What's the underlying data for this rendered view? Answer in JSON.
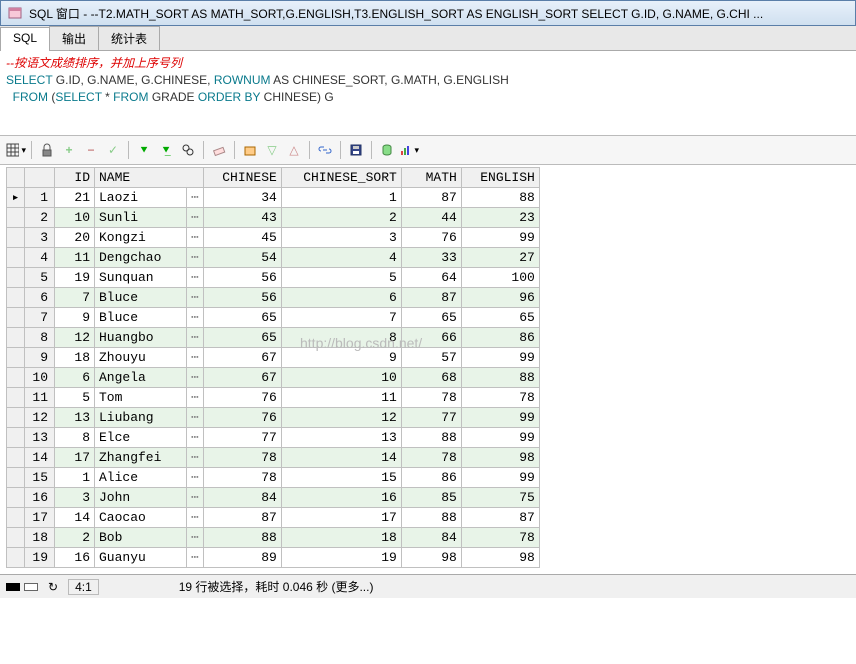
{
  "window": {
    "title": "SQL 窗口 - --T2.MATH_SORT AS MATH_SORT,G.ENGLISH,T3.ENGLISH_SORT AS ENGLISH_SORT SELECT G.ID, G.NAME, G.CHI ..."
  },
  "tabs": {
    "items": [
      "SQL",
      "输出",
      "统计表"
    ],
    "active_index": 0
  },
  "sql": {
    "comment": "--按语文成绩排序，并加上序号列",
    "line1_kw1": "SELECT",
    "line1_rest": " G.ID, G.NAME, G.CHINESE, ",
    "line1_kw2": "ROWNUM",
    "line1_rest2": " AS CHINESE_SORT, G.MATH, G.ENGLISH",
    "line2_kw1": "FROM",
    "line2_rest1": " (",
    "line2_kw2": "SELECT",
    "line2_rest2": " * ",
    "line2_kw3": "FROM",
    "line2_rest3": " GRADE ",
    "line2_kw4": "ORDER",
    "line2_kw5": "BY",
    "line2_rest4": " CHINESE) G"
  },
  "grid": {
    "headers": [
      "ID",
      "NAME",
      "CHINESE",
      "CHINESE_SORT",
      "MATH",
      "ENGLISH"
    ],
    "rows": [
      {
        "n": 1,
        "id": 21,
        "name": "Laozi",
        "chinese": 34,
        "sort": 1,
        "math": 87,
        "english": 88
      },
      {
        "n": 2,
        "id": 10,
        "name": "Sunli",
        "chinese": 43,
        "sort": 2,
        "math": 44,
        "english": 23
      },
      {
        "n": 3,
        "id": 20,
        "name": "Kongzi",
        "chinese": 45,
        "sort": 3,
        "math": 76,
        "english": 99
      },
      {
        "n": 4,
        "id": 11,
        "name": "Dengchao",
        "chinese": 54,
        "sort": 4,
        "math": 33,
        "english": 27
      },
      {
        "n": 5,
        "id": 19,
        "name": "Sunquan",
        "chinese": 56,
        "sort": 5,
        "math": 64,
        "english": 100
      },
      {
        "n": 6,
        "id": 7,
        "name": "Bluce",
        "chinese": 56,
        "sort": 6,
        "math": 87,
        "english": 96
      },
      {
        "n": 7,
        "id": 9,
        "name": "Bluce",
        "chinese": 65,
        "sort": 7,
        "math": 65,
        "english": 65
      },
      {
        "n": 8,
        "id": 12,
        "name": "Huangbo",
        "chinese": 65,
        "sort": 8,
        "math": 66,
        "english": 86
      },
      {
        "n": 9,
        "id": 18,
        "name": "Zhouyu",
        "chinese": 67,
        "sort": 9,
        "math": 57,
        "english": 99
      },
      {
        "n": 10,
        "id": 6,
        "name": "Angela",
        "chinese": 67,
        "sort": 10,
        "math": 68,
        "english": 88
      },
      {
        "n": 11,
        "id": 5,
        "name": "Tom",
        "chinese": 76,
        "sort": 11,
        "math": 78,
        "english": 78
      },
      {
        "n": 12,
        "id": 13,
        "name": "Liubang",
        "chinese": 76,
        "sort": 12,
        "math": 77,
        "english": 99
      },
      {
        "n": 13,
        "id": 8,
        "name": "Elce",
        "chinese": 77,
        "sort": 13,
        "math": 88,
        "english": 99
      },
      {
        "n": 14,
        "id": 17,
        "name": "Zhangfei",
        "chinese": 78,
        "sort": 14,
        "math": 78,
        "english": 98
      },
      {
        "n": 15,
        "id": 1,
        "name": "Alice",
        "chinese": 78,
        "sort": 15,
        "math": 86,
        "english": 99
      },
      {
        "n": 16,
        "id": 3,
        "name": "John",
        "chinese": 84,
        "sort": 16,
        "math": 85,
        "english": 75
      },
      {
        "n": 17,
        "id": 14,
        "name": "Caocao",
        "chinese": 87,
        "sort": 17,
        "math": 88,
        "english": 87
      },
      {
        "n": 18,
        "id": 2,
        "name": "Bob",
        "chinese": 88,
        "sort": 18,
        "math": 84,
        "english": 78
      },
      {
        "n": 19,
        "id": 16,
        "name": "Guanyu",
        "chinese": 89,
        "sort": 19,
        "math": 98,
        "english": 98
      }
    ]
  },
  "watermark": "http://blog.csdn.net/",
  "status": {
    "cursor": "4:1",
    "message": "19 行被选择，耗时 0.046 秒 (更多...)"
  },
  "toolbar_icons": [
    "grid-icon",
    "lock-icon",
    "plus-icon",
    "minus-icon",
    "check-icon",
    "exec-icon",
    "exec-next-icon",
    "find-icon",
    "eraser-icon",
    "browse-icon",
    "down-icon",
    "up-icon",
    "link-icon",
    "save-icon",
    "db-icon",
    "chart-icon"
  ]
}
